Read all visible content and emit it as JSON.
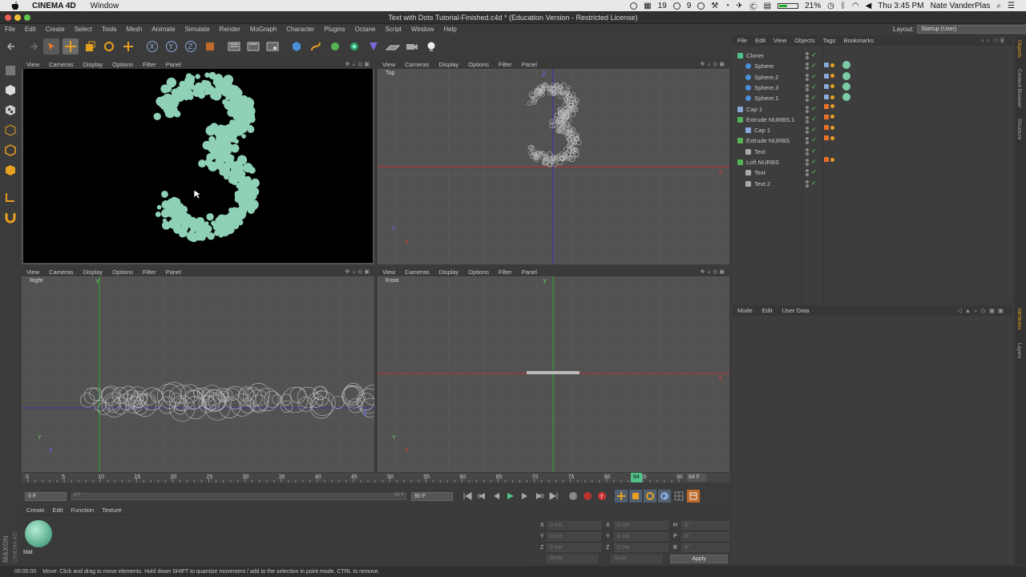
{
  "mac_menubar": {
    "app_name": "CINEMA 4D",
    "menu": "Window",
    "badge_count": "19",
    "badge_count2": "9",
    "battery_pct": "21%",
    "clock": "Thu 3:45 PM",
    "user": "Nate VanderPlas"
  },
  "window_title": "Text with Dots Tutorial-Finished.c4d * (Education Version - Restricted License)",
  "main_menu": [
    "File",
    "Edit",
    "Create",
    "Select",
    "Tools",
    "Mesh",
    "Animate",
    "Simulate",
    "Render",
    "MoGraph",
    "Character",
    "Plugins",
    "Octane",
    "Script",
    "Window",
    "Help"
  ],
  "layout": {
    "label": "Layout:",
    "value": "Startup (User)"
  },
  "viewport_menu": [
    "View",
    "Cameras",
    "Display",
    "Options",
    "Filter",
    "Panel"
  ],
  "viewports": {
    "top": "Top",
    "right": "Right",
    "front": "Front"
  },
  "axis": {
    "x": "X",
    "y": "Y",
    "z": "Z"
  },
  "timeline": {
    "ticks": [
      "0",
      "5",
      "10",
      "15",
      "20",
      "25",
      "30",
      "35",
      "40",
      "45",
      "50",
      "55",
      "60",
      "65",
      "70",
      "75",
      "80",
      "85",
      "90"
    ],
    "current_frame": "84",
    "end_label": "84 F",
    "current": 84,
    "end": 90
  },
  "transport": {
    "start": "0 F",
    "range_start": "0 F",
    "range_end": "90 F",
    "end": "90 F"
  },
  "material_panel": {
    "menu": [
      "Create",
      "Edit",
      "Function",
      "Texture"
    ],
    "material_name": "Mat",
    "material_color": "#7ccaa6"
  },
  "coordinates": {
    "rows": [
      {
        "a": "X",
        "av": "0 cm",
        "b": "X",
        "bv": "0 cm",
        "c": "H",
        "cv": "0 °"
      },
      {
        "a": "Y",
        "av": "0 cm",
        "b": "Y",
        "bv": "0 cm",
        "c": "P",
        "cv": "0 °"
      },
      {
        "a": "Z",
        "av": "0 cm",
        "b": "Z",
        "bv": "0 cm",
        "c": "B",
        "cv": "0 °"
      }
    ],
    "world": "World",
    "scale": "Scale",
    "apply": "Apply"
  },
  "status": {
    "time": "00:00:00",
    "message": "Move: Click and drag to move elements. Hold down SHIFT to quantize movement / add to the selection in point mode, CTRL to remove."
  },
  "object_manager": {
    "menu": [
      "File",
      "Edit",
      "View",
      "Objects",
      "Tags",
      "Bookmarks"
    ],
    "objects": [
      {
        "name": "Cloner",
        "indent": 0,
        "icon": "cloner"
      },
      {
        "name": "Sphere",
        "indent": 1,
        "icon": "sphere"
      },
      {
        "name": "Sphere.2",
        "indent": 1,
        "icon": "sphere"
      },
      {
        "name": "Sphere.3",
        "indent": 1,
        "icon": "sphere"
      },
      {
        "name": "Sphere.1",
        "indent": 1,
        "icon": "sphere"
      },
      {
        "name": "Cap 1",
        "indent": 0,
        "icon": "cap"
      },
      {
        "name": "Extrude NURBS.1",
        "indent": 0,
        "icon": "extrude"
      },
      {
        "name": "Cap 1",
        "indent": 1,
        "icon": "cap"
      },
      {
        "name": "Extrude NURBS",
        "indent": 0,
        "icon": "extrude"
      },
      {
        "name": "Text",
        "indent": 1,
        "icon": "text"
      },
      {
        "name": "Loft NURBS",
        "indent": 0,
        "icon": "loft"
      },
      {
        "name": "Text",
        "indent": 1,
        "icon": "text"
      },
      {
        "name": "Text.2",
        "indent": 1,
        "icon": "text"
      }
    ]
  },
  "attributes": {
    "menu": [
      "Mode",
      "Edit",
      "User Data"
    ]
  },
  "side_tabs": {
    "objects": "Objects",
    "content_browser": "Content Browser",
    "structure": "Structure",
    "attributes": "Attributes",
    "layers": "Layers"
  },
  "maxon": {
    "brand": "MAXON",
    "product": "CINEMA 4D"
  },
  "colors": {
    "dot": "#8fd1b6",
    "accent": "#4fc387"
  }
}
